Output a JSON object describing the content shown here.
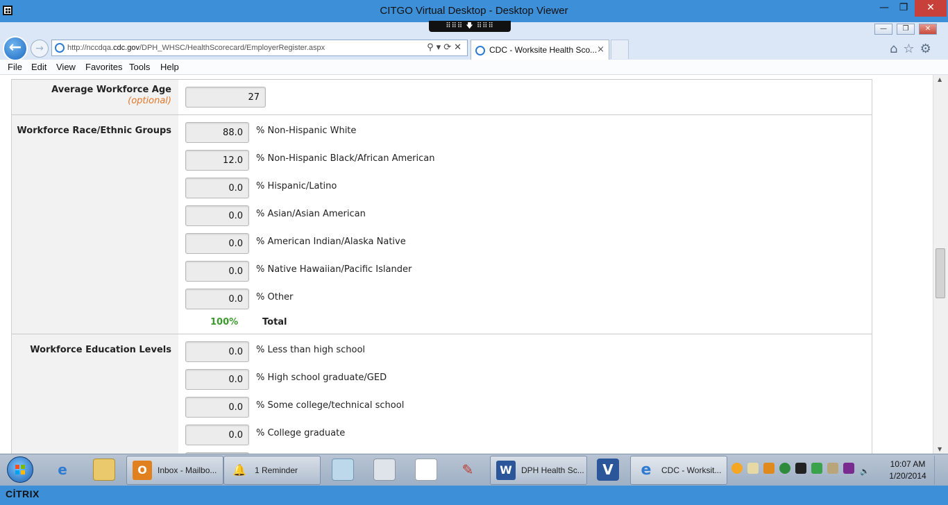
{
  "window": {
    "title": "CITGO Virtual Desktop - Desktop Viewer",
    "minimize_glyph": "—",
    "restore_glyph": "❐",
    "close_glyph": "✕",
    "grip_text": "⠿⠿⠿ 🡇 ⠿⠿⠿"
  },
  "browser": {
    "url_prefix": "http://nccdqa.",
    "url_domain": "cdc.gov",
    "url_path": "/DPH_WHSC/HealthScorecard/EmployerRegister.aspx",
    "address_tools": "⚲▾⟳✕",
    "tab_label": "CDC - Worksite Health Sco...",
    "tab_close": "×",
    "back_glyph": "←",
    "forward_glyph": "→",
    "right_icons": "⌂☆⚙",
    "menu": [
      "File",
      "Edit",
      "View",
      "Favorites",
      "Tools",
      "Help"
    ]
  },
  "form": {
    "avg_age": {
      "label": "Average Workforce Age",
      "sub": "(optional)",
      "value": "27"
    },
    "race": {
      "label": "Workforce Race/Ethnic Groups",
      "rows": [
        {
          "value": "88.0",
          "label": "% Non-Hispanic White"
        },
        {
          "value": "12.0",
          "label": "% Non-Hispanic Black/African American"
        },
        {
          "value": "0.0",
          "label": "% Hispanic/Latino"
        },
        {
          "value": "0.0",
          "label": "% Asian/Asian American"
        },
        {
          "value": "0.0",
          "label": "% American Indian/Alaska Native"
        },
        {
          "value": "0.0",
          "label": "% Native Hawaiian/Pacific Islander"
        },
        {
          "value": "0.0",
          "label": "% Other"
        }
      ],
      "total_pct": "100%",
      "total_label": "Total"
    },
    "education": {
      "label": "Workforce Education Levels",
      "rows": [
        {
          "value": "0.0",
          "label": "% Less than high school"
        },
        {
          "value": "0.0",
          "label": "% High school graduate/GED"
        },
        {
          "value": "0.0",
          "label": "% Some college/technical school"
        },
        {
          "value": "0.0",
          "label": "% College graduate"
        }
      ]
    }
  },
  "taskbar": {
    "buttons": [
      {
        "label": "Inbox - Mailbo...",
        "icon": "O",
        "icon_color": "#e0801f"
      },
      {
        "label": "1 Reminder",
        "icon": "🔔",
        "icon_color": "transparent"
      },
      {
        "label": "DPH Health Sc...",
        "icon": "W",
        "icon_color": "#2b579a"
      },
      {
        "label": "CDC - Worksit...",
        "icon": "e",
        "icon_color": "#2f7bd1"
      }
    ],
    "pinned_icons": [
      "ie-icon",
      "explorer-icon",
      "notepad-icon",
      "calculator-icon",
      "document-icon",
      "tools-icon",
      "visio-icon"
    ],
    "clock_time": "10:07 AM",
    "clock_date": "1/20/2014"
  },
  "citrix": {
    "brand": "CİTRIX"
  }
}
